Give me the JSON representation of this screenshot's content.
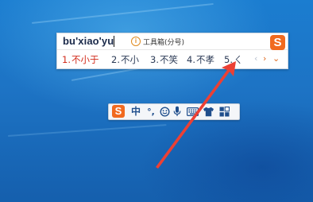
{
  "ime": {
    "composition_text": "bu'xiao'yu",
    "toolbox_hint": "工具箱(分号)",
    "candidates": [
      {
        "num": "1.",
        "text": "不小于"
      },
      {
        "num": "2.",
        "text": "不小"
      },
      {
        "num": "3.",
        "text": "不笑"
      },
      {
        "num": "4.",
        "text": "不孝"
      },
      {
        "num": "5.",
        "text": "ㄑ"
      }
    ],
    "logo_letter": "S"
  },
  "status_bar": {
    "logo_letter": "S",
    "mode_label": "中",
    "punct_label": "°,"
  },
  "colors": {
    "desktop_blue": "#1e78c8",
    "sogou_orange": "#f16a1f",
    "highlight_red": "#d12a1a",
    "arrow_red": "#ec4034"
  },
  "icons": [
    "info-icon",
    "prev-page-icon",
    "next-page-icon",
    "expand-chevron-icon",
    "emoji-icon",
    "microphone-icon",
    "keyboard-icon",
    "skin-tshirt-icon",
    "toolbox-grid-icon"
  ]
}
